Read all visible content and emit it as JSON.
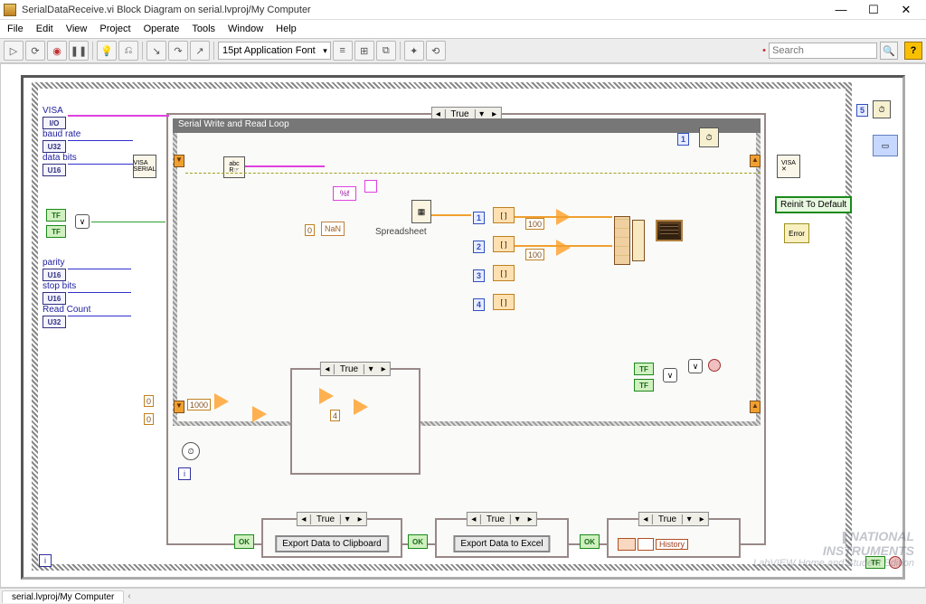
{
  "window": {
    "title": "SerialDataReceive.vi Block Diagram on serial.lvproj/My Computer",
    "min_glyph": "—",
    "max_glyph": "☐",
    "close_glyph": "✕"
  },
  "menu": [
    "File",
    "Edit",
    "View",
    "Project",
    "Operate",
    "Tools",
    "Window",
    "Help"
  ],
  "toolbar": {
    "font": "15pt Application Font",
    "search_placeholder": "Search"
  },
  "structures": {
    "outer_case_selector": "True",
    "inner_loop_label": "Serial Write and Read Loop",
    "inner_case_selector": "True",
    "export_case1": "True",
    "export_case2": "True",
    "export_case3": "True"
  },
  "controls": {
    "visa": {
      "label": "VISA",
      "type": "I/O"
    },
    "baud": {
      "label": "baud rate",
      "type": "U32"
    },
    "databits": {
      "label": "data bits",
      "type": "U16"
    },
    "parity": {
      "label": "parity",
      "type": "U16"
    },
    "stopbits": {
      "label": "stop bits",
      "type": "U16"
    },
    "readcount": {
      "label": "Read Count",
      "type": "U32"
    }
  },
  "constants": {
    "one": "1",
    "five_top": "5",
    "zero_a": "0",
    "zero_b": "0",
    "thousand": "1000",
    "zero_idx": "0",
    "nan": "NaN",
    "fmt": "%f",
    "idx1": "1",
    "idx2": "2",
    "idx3": "3",
    "idx4": "4",
    "hundred_a": "100",
    "hundred_b": "100",
    "four_c": "4"
  },
  "nodes": {
    "spreadsheet_label": "Spreadsheet",
    "reinit": "Reinit To Default",
    "export1": "Export Data to Clipboard",
    "export2": "Export Data to Excel",
    "history": "History",
    "ok": "OK",
    "tf": "TF",
    "error": "Error"
  },
  "statusbar": {
    "tab": "serial.lvproj/My Computer"
  },
  "watermark": {
    "l1": "NATIONAL",
    "l2": "INSTRUMENTS",
    "l3": "LabVIEW Home and Student Edition"
  }
}
